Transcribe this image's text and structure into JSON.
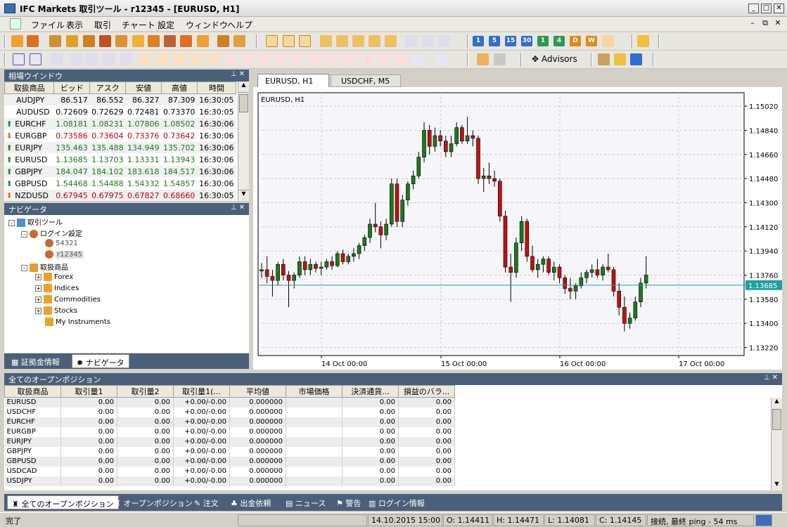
{
  "window": {
    "title": "IFC Markets 取引ツール - r12345  - [EURUSD, H1]"
  },
  "menu": [
    "ファイル",
    "表示",
    "取引",
    "チャート",
    "設定",
    "ウィンドウ",
    "ヘルプ"
  ],
  "toolbar": {
    "timeframes": [
      "1",
      "5",
      "15",
      "30",
      "1",
      "4",
      "D",
      "W"
    ],
    "advisors_label": "Advisors"
  },
  "market_watch": {
    "title": "相場ウインドウ",
    "columns": [
      "取扱商品",
      "ビッド",
      "アスク",
      "安値",
      "高値",
      "時間"
    ],
    "rows": [
      {
        "sym": "AUDJPY",
        "dir": "none",
        "bid": "86.517",
        "ask": "86.552",
        "low": "86.327",
        "high": "87.309",
        "time": "16:30:05"
      },
      {
        "sym": "AUDUSD",
        "dir": "none",
        "bid": "0.72609",
        "ask": "0.72629",
        "low": "0.72481",
        "high": "0.73370",
        "time": "16:30:05"
      },
      {
        "sym": "EURCHF",
        "dir": "up",
        "bid": "1.08181",
        "ask": "1.08231",
        "low": "1.07806",
        "high": "1.08502",
        "time": "16:30:06"
      },
      {
        "sym": "EURGBP",
        "dir": "down",
        "bid": "0.73586",
        "ask": "0.73604",
        "low": "0.73376",
        "high": "0.73642",
        "time": "16:30:06"
      },
      {
        "sym": "EURJPY",
        "dir": "up",
        "bid": "135.463",
        "ask": "135.488",
        "low": "134.949",
        "high": "135.702",
        "time": "16:30:06"
      },
      {
        "sym": "EURUSD",
        "dir": "up",
        "bid": "1.13685",
        "ask": "1.13703",
        "low": "1.13331",
        "high": "1.13943",
        "time": "16:30:06"
      },
      {
        "sym": "GBPJPY",
        "dir": "up",
        "bid": "184.047",
        "ask": "184.102",
        "low": "183.618",
        "high": "184.517",
        "time": "16:30:06"
      },
      {
        "sym": "GBPUSD",
        "dir": "up",
        "bid": "1.54468",
        "ask": "1.54488",
        "low": "1.54332",
        "high": "1.54857",
        "time": "16:30:06"
      },
      {
        "sym": "NZDUSD",
        "dir": "down",
        "bid": "0.67945",
        "ask": "0.67975",
        "low": "0.67827",
        "high": "0.68660",
        "time": "16:30:05"
      }
    ]
  },
  "navigator": {
    "title": "ナビゲータ",
    "root": "取引ツール",
    "login_settings": "ログイン設定",
    "accounts": [
      "54321",
      "r12345"
    ],
    "instruments": "取扱商品",
    "groups": [
      "Forex",
      "Indices",
      "Commodities",
      "Stocks",
      "My Instruments"
    ],
    "tabs": [
      "証拠金情報",
      "ナビゲータ"
    ]
  },
  "chart": {
    "tabs": [
      "EURUSD, H1",
      "USDCHF, M5"
    ],
    "label": "EURUSD, H1",
    "price_labels": [
      "1.15020",
      "1.14840",
      "1.14660",
      "1.14480",
      "1.14300",
      "1.14120",
      "1.13940",
      "1.13760",
      "1.13580",
      "1.13400",
      "1.13220"
    ],
    "current_price": "1.13685",
    "time_labels": [
      "14 Oct 00:00",
      "15 Oct 00:00",
      "16 Oct 00:00",
      "17 Oct 00:00"
    ],
    "colors": {
      "up": "#1a7a1a",
      "down": "#c41010",
      "line": "#20a0a0"
    }
  },
  "chart_data": {
    "type": "candlestick",
    "symbol": "EURUSD",
    "timeframe": "H1",
    "ylim": [
      1.1316,
      1.1512
    ],
    "candles": [
      [
        1.1379,
        1.1385,
        1.1374,
        1.138
      ],
      [
        1.138,
        1.139,
        1.137,
        1.1375
      ],
      [
        1.1375,
        1.138,
        1.136,
        1.1372
      ],
      [
        1.1372,
        1.1386,
        1.1368,
        1.1384
      ],
      [
        1.1384,
        1.1388,
        1.1372,
        1.1376
      ],
      [
        1.1376,
        1.1379,
        1.1352,
        1.1372
      ],
      [
        1.1372,
        1.1378,
        1.1366,
        1.1376
      ],
      [
        1.1376,
        1.139,
        1.1374,
        1.1386
      ],
      [
        1.1386,
        1.139,
        1.1376,
        1.138
      ],
      [
        1.138,
        1.1388,
        1.1376,
        1.1384
      ],
      [
        1.1384,
        1.1386,
        1.1378,
        1.1381
      ],
      [
        1.1381,
        1.1386,
        1.1376,
        1.1382
      ],
      [
        1.1382,
        1.1388,
        1.138,
        1.1386
      ],
      [
        1.1386,
        1.139,
        1.138,
        1.1383
      ],
      [
        1.1383,
        1.1394,
        1.1382,
        1.1392
      ],
      [
        1.1392,
        1.1395,
        1.1384,
        1.1386
      ],
      [
        1.1386,
        1.1392,
        1.1384,
        1.139
      ],
      [
        1.139,
        1.1396,
        1.1386,
        1.1392
      ],
      [
        1.1392,
        1.14,
        1.1388,
        1.1398
      ],
      [
        1.1398,
        1.1406,
        1.1394,
        1.1404
      ],
      [
        1.1404,
        1.1418,
        1.14,
        1.1414
      ],
      [
        1.1414,
        1.143,
        1.1408,
        1.1412
      ],
      [
        1.1412,
        1.1416,
        1.1396,
        1.1406
      ],
      [
        1.1406,
        1.1418,
        1.1402,
        1.1414
      ],
      [
        1.1414,
        1.1448,
        1.1412,
        1.1444
      ],
      [
        1.1444,
        1.1448,
        1.1412,
        1.1416
      ],
      [
        1.1416,
        1.1436,
        1.1412,
        1.1432
      ],
      [
        1.1432,
        1.1446,
        1.1428,
        1.1444
      ],
      [
        1.1444,
        1.1454,
        1.144,
        1.145
      ],
      [
        1.145,
        1.1468,
        1.1448,
        1.1464
      ],
      [
        1.1464,
        1.149,
        1.146,
        1.1484
      ],
      [
        1.1484,
        1.1488,
        1.1466,
        1.1472
      ],
      [
        1.1472,
        1.1486,
        1.1468,
        1.148
      ],
      [
        1.148,
        1.1484,
        1.1472,
        1.1476
      ],
      [
        1.1476,
        1.148,
        1.1464,
        1.1468
      ],
      [
        1.1468,
        1.148,
        1.1464,
        1.1474
      ],
      [
        1.1474,
        1.149,
        1.1472,
        1.1486
      ],
      [
        1.1486,
        1.1488,
        1.1474,
        1.1476
      ],
      [
        1.1476,
        1.1494,
        1.1474,
        1.148
      ],
      [
        1.148,
        1.1484,
        1.1472,
        1.1478
      ],
      [
        1.1478,
        1.148,
        1.1444,
        1.1448
      ],
      [
        1.1448,
        1.1456,
        1.1438,
        1.145
      ],
      [
        1.145,
        1.146,
        1.1444,
        1.1448
      ],
      [
        1.1448,
        1.1454,
        1.1442,
        1.1446
      ],
      [
        1.1446,
        1.1448,
        1.1416,
        1.142
      ],
      [
        1.142,
        1.1424,
        1.1378,
        1.1382
      ],
      [
        1.1382,
        1.1392,
        1.1356,
        1.1378
      ],
      [
        1.1378,
        1.1404,
        1.1374,
        1.14
      ],
      [
        1.14,
        1.142,
        1.1394,
        1.1416
      ],
      [
        1.1416,
        1.1418,
        1.1386,
        1.139
      ],
      [
        1.139,
        1.1398,
        1.1378,
        1.138
      ],
      [
        1.138,
        1.1388,
        1.1374,
        1.1384
      ],
      [
        1.1384,
        1.139,
        1.1378,
        1.1388
      ],
      [
        1.1388,
        1.139,
        1.1376,
        1.1378
      ],
      [
        1.1378,
        1.1386,
        1.1372,
        1.1382
      ],
      [
        1.1382,
        1.1384,
        1.137,
        1.1374
      ],
      [
        1.1374,
        1.1376,
        1.1362,
        1.1366
      ],
      [
        1.1366,
        1.1374,
        1.1358,
        1.1364
      ],
      [
        1.1364,
        1.137,
        1.1358,
        1.1368
      ],
      [
        1.1368,
        1.1378,
        1.1366,
        1.1374
      ],
      [
        1.1374,
        1.138,
        1.137,
        1.1378
      ],
      [
        1.1378,
        1.1384,
        1.1374,
        1.138
      ],
      [
        1.138,
        1.1388,
        1.1374,
        1.1376
      ],
      [
        1.1376,
        1.1384,
        1.1372,
        1.1382
      ],
      [
        1.1382,
        1.1392,
        1.1378,
        1.138
      ],
      [
        1.138,
        1.1382,
        1.136,
        1.1364
      ],
      [
        1.1364,
        1.137,
        1.1346,
        1.1352
      ],
      [
        1.1352,
        1.136,
        1.1334,
        1.134
      ],
      [
        1.134,
        1.1348,
        1.1336,
        1.1344
      ],
      [
        1.1344,
        1.136,
        1.1342,
        1.1356
      ],
      [
        1.1356,
        1.1374,
        1.1352,
        1.137
      ],
      [
        1.137,
        1.139,
        1.1366,
        1.1376
      ]
    ]
  },
  "positions": {
    "title": "全てのオープンポジション",
    "columns": [
      "取扱商品",
      "取引量1",
      "取引量2",
      "取引量1(...",
      "平均値",
      "市場価格",
      "決済通貨...",
      "損益のバラ..."
    ],
    "rows": [
      {
        "sym": "EURUSD",
        "v1": "0.00",
        "v2": "0.00",
        "v3": "+0.00/-0.00",
        "avg": "0.000000",
        "mkt": "",
        "ccy": "0.00",
        "pl": "0.00"
      },
      {
        "sym": "USDCHF",
        "v1": "0.00",
        "v2": "0.00",
        "v3": "+0.00/-0.00",
        "avg": "0.000000",
        "mkt": "",
        "ccy": "0.00",
        "pl": "0.00"
      },
      {
        "sym": "EURCHF",
        "v1": "0.00",
        "v2": "0.00",
        "v3": "+0.00/-0.00",
        "avg": "0.000000",
        "mkt": "",
        "ccy": "0.00",
        "pl": "0.00"
      },
      {
        "sym": "EURGBP",
        "v1": "0.00",
        "v2": "0.00",
        "v3": "+0.00/-0.00",
        "avg": "0.000000",
        "mkt": "",
        "ccy": "0.00",
        "pl": "0.00"
      },
      {
        "sym": "EURJPY",
        "v1": "0.00",
        "v2": "0.00",
        "v3": "+0.00/-0.00",
        "avg": "0.000000",
        "mkt": "",
        "ccy": "0.00",
        "pl": "0.00"
      },
      {
        "sym": "GBPJPY",
        "v1": "0.00",
        "v2": "0.00",
        "v3": "+0.00/-0.00",
        "avg": "0.000000",
        "mkt": "",
        "ccy": "0.00",
        "pl": "0.00"
      },
      {
        "sym": "GBPUSD",
        "v1": "0.00",
        "v2": "0.00",
        "v3": "+0.00/-0.00",
        "avg": "0.000000",
        "mkt": "",
        "ccy": "0.00",
        "pl": "0.00"
      },
      {
        "sym": "USDCAD",
        "v1": "0.00",
        "v2": "0.00",
        "v3": "+0.00/-0.00",
        "avg": "0.000000",
        "mkt": "",
        "ccy": "0.00",
        "pl": "0.00"
      },
      {
        "sym": "USDJPY",
        "v1": "0.00",
        "v2": "0.00",
        "v3": "+0.00/-0.00",
        "avg": "0.000000",
        "mkt": "",
        "ccy": "0.00",
        "pl": "0.00"
      }
    ],
    "tabs": [
      "全てのオープンポジション",
      "オープンポジション",
      "注文",
      "出金依頼",
      "ニュース",
      "警告",
      "ログイン情報"
    ]
  },
  "status": {
    "ready": "完了",
    "datetime": "14.10.2015 15:00",
    "open": "O: 1.14411",
    "high": "H: 1.14471",
    "low": "L: 1.14081",
    "close": "C: 1.14145",
    "ping": "接続, 最終 ping - 54 ms"
  }
}
